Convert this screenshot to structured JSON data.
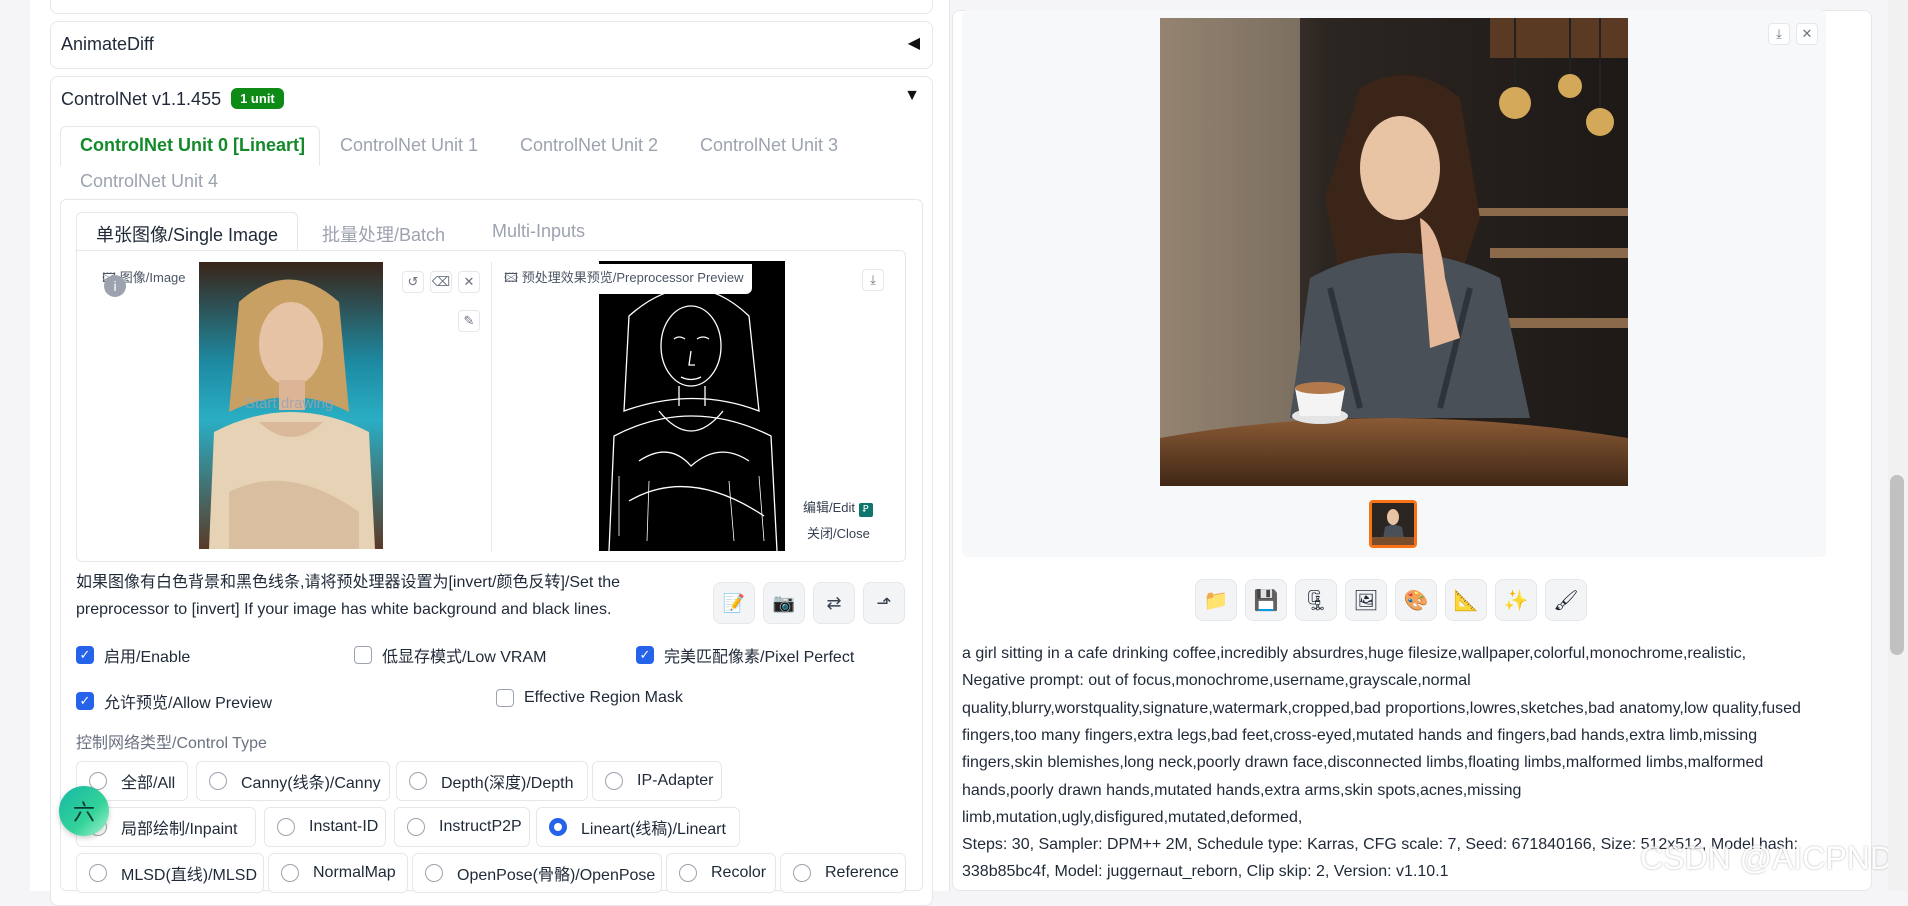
{
  "animatediff": {
    "title": "AnimateDiff"
  },
  "controlnet": {
    "title": "ControlNet v1.1.455",
    "badge": "1 unit",
    "tabs": [
      "ControlNet Unit 0 [Lineart]",
      "ControlNet Unit 1",
      "ControlNet Unit 2",
      "ControlNet Unit 3",
      "ControlNet Unit 4"
    ],
    "subtabs": [
      "单张图像/Single Image",
      "批量处理/Batch",
      "Multi-Inputs"
    ],
    "image_label": "图像/Image",
    "start_drawing": "Start drawing",
    "preview_label": "预处理效果预览/Preprocessor Preview",
    "edit_label": "编辑/Edit",
    "close_label": "关闭/Close",
    "hint_line1": "如果图像有白色背景和黑色线条,请将预处理器设置为[invert/颜色反转]/Set the",
    "hint_line2": "preprocessor to [invert] If your image has white background and black lines.",
    "checkboxes": [
      {
        "label": "启用/Enable",
        "checked": true
      },
      {
        "label": "低显存模式/Low VRAM",
        "checked": false
      },
      {
        "label": "完美匹配像素/Pixel Perfect",
        "checked": true
      },
      {
        "label": "允许预览/Allow Preview",
        "checked": true
      },
      {
        "label": "Effective Region Mask",
        "checked": false
      }
    ],
    "control_type_label": "控制网络类型/Control Type",
    "control_types": [
      "全部/All",
      "Canny(线条)/Canny",
      "Depth(深度)/Depth",
      "IP-Adapter",
      "局部绘制/Inpaint",
      "Instant-ID",
      "InstructP2P",
      "Lineart(线稿)/Lineart",
      "MLSD(直线)/MLSD",
      "NormalMap",
      "OpenPose(骨骼)/OpenPose",
      "Recolor",
      "Reference"
    ],
    "selected_control_type": "Lineart(线稿)/Lineart"
  },
  "float_badge": "六",
  "output": {
    "info_lines": [
      "a girl sitting in a cafe drinking coffee,incredibly absurdres,huge filesize,wallpaper,colorful,monochrome,realistic,",
      "Negative prompt: out of focus,monochrome,username,grayscale,normal",
      "quality,blurry,worstquality,signature,watermark,cropped,bad proportions,lowres,sketches,bad anatomy,low quality,fused",
      "fingers,too many fingers,extra legs,bad feet,cross-eyed,mutated hands and fingers,bad hands,extra limb,missing",
      "fingers,skin blemishes,long neck,poorly drawn face,disconnected limbs,floating limbs,malformed limbs,malformed",
      "hands,poorly drawn hands,mutated hands,extra arms,skin spots,acnes,missing",
      "limb,mutation,ugly,disfigured,mutated,deformed,",
      "Steps: 30, Sampler: DPM++ 2M, Schedule type: Karras, CFG scale: 7, Seed: 671840166, Size: 512x512, Model hash:",
      "338b85bc4f, Model: juggernaut_reborn, Clip skip: 2, Version: v1.10.1"
    ]
  },
  "watermark": "CSDN @AICPND",
  "icons": {
    "gen_buttons": [
      "folder-icon",
      "save-icon",
      "zip-icon",
      "image-icon",
      "palette-icon",
      "ruler-icon",
      "sparkle-icon",
      "brush-icon"
    ],
    "gen_glyphs": [
      "📁",
      "💾",
      "🗜",
      "🖼",
      "🎨",
      "📐",
      "✨",
      "🖌"
    ]
  },
  "colors": {
    "accent": "#138a2a",
    "badge": "#0e8a16",
    "check": "#2563eb"
  }
}
